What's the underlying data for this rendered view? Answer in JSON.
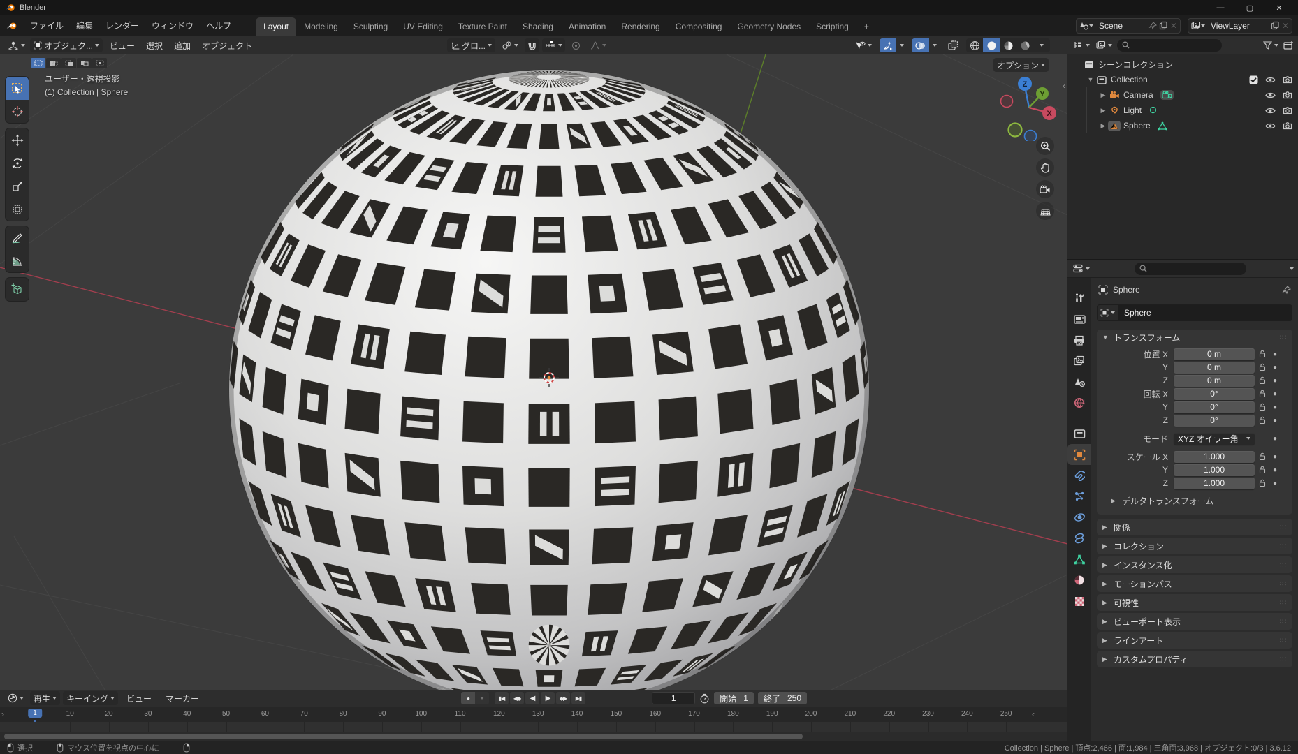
{
  "window": {
    "title": "Blender"
  },
  "topbar": {
    "menus": [
      "ファイル",
      "編集",
      "レンダー",
      "ウィンドウ",
      "ヘルプ"
    ],
    "workspaces": [
      "Layout",
      "Modeling",
      "Sculpting",
      "UV Editing",
      "Texture Paint",
      "Shading",
      "Animation",
      "Rendering",
      "Compositing",
      "Geometry Nodes",
      "Scripting",
      "+"
    ],
    "active_workspace": "Layout",
    "scene_name": "Scene",
    "view_layer_name": "ViewLayer"
  },
  "viewport": {
    "mode": "オブジェク...",
    "menus": [
      "ビュー",
      "選択",
      "追加",
      "オブジェクト"
    ],
    "orientation": "グロ...",
    "options_label": "オプション",
    "info_line1": "ユーザー・透視投影",
    "info_line2": "(1) Collection | Sphere",
    "gizmo": {
      "x": "X",
      "y": "Y",
      "z": "Z"
    }
  },
  "outliner": {
    "rows": [
      {
        "label": "シーンコレクション",
        "depth": 0,
        "twisty": "",
        "icon": "scene-collection",
        "badge": "",
        "toggles": [
          "filter"
        ]
      },
      {
        "label": "Collection",
        "depth": 1,
        "twisty": "▼",
        "icon": "collection",
        "badge": "",
        "toggles": [
          "check",
          "eye",
          "camera"
        ]
      },
      {
        "label": "Camera",
        "depth": 2,
        "twisty": "▶",
        "icon": "camera-obj",
        "badge": "camera-data",
        "toggles": [
          "eye",
          "camera"
        ]
      },
      {
        "label": "Light",
        "depth": 2,
        "twisty": "▶",
        "icon": "light-obj",
        "badge": "light-data",
        "toggles": [
          "eye",
          "camera"
        ]
      },
      {
        "label": "Sphere",
        "depth": 2,
        "twisty": "▶",
        "icon": "mesh-obj",
        "badge": "mesh-data",
        "selected": true,
        "toggles": [
          "eye",
          "camera"
        ]
      }
    ]
  },
  "properties": {
    "breadcrumb": "Sphere",
    "object_name": "Sphere",
    "tabs": [
      "tool",
      "render",
      "output",
      "view-layer",
      "scene",
      "world",
      "collection",
      "object",
      "modifiers",
      "particles",
      "physics",
      "constraints",
      "object-data",
      "material",
      "texture"
    ],
    "active_tab": "object",
    "transform": {
      "title": "トランスフォーム",
      "rows": [
        {
          "label": "位置 X",
          "value": "0 m"
        },
        {
          "label": "Y",
          "value": "0 m"
        },
        {
          "label": "Z",
          "value": "0 m"
        },
        {
          "label": "回転 X",
          "value": "0°"
        },
        {
          "label": "Y",
          "value": "0°"
        },
        {
          "label": "Z",
          "value": "0°"
        }
      ],
      "mode_label": "モード",
      "mode_value": "XYZ オイラー角",
      "scale_rows": [
        {
          "label": "スケール X",
          "value": "1.000"
        },
        {
          "label": "Y",
          "value": "1.000"
        },
        {
          "label": "Z",
          "value": "1.000"
        }
      ],
      "delta_label": "デルタトランスフォーム"
    },
    "sections": [
      "関係",
      "コレクション",
      "インスタンス化",
      "モーションパス",
      "可視性",
      "ビューポート表示",
      "ラインアート",
      "カスタムプロパティ"
    ]
  },
  "timeline": {
    "menus": [
      "再生",
      "キーイング",
      "ビュー",
      "マーカー"
    ],
    "current_frame": "1",
    "ticks": [
      10,
      20,
      30,
      40,
      50,
      60,
      70,
      80,
      90,
      100,
      110,
      120,
      130,
      140,
      150,
      160,
      170,
      180,
      190,
      200,
      210,
      220,
      230,
      240,
      250
    ],
    "start_label": "開始",
    "start_value": "1",
    "end_label": "終了",
    "end_value": "250"
  },
  "statusbar": {
    "hints": [
      {
        "icon": "mouse-left",
        "label": "選択"
      },
      {
        "icon": "mouse-middle",
        "label": "マウス位置を視点の中心に"
      },
      {
        "icon": "mouse-right",
        "label": ""
      }
    ],
    "stats": "Collection | Sphere | 頂点:2,466 | 面:1,984 | 三角面:3,968 | オブジェクト:0/3 | 3.6.12"
  },
  "colors": {
    "accent": "#4772b3",
    "axis_x": "#c84a5f",
    "axis_y": "#6d9e33",
    "axis_z": "#3b7fd4",
    "object_orange": "#e0883d",
    "data_green": "#3fd6a4"
  }
}
